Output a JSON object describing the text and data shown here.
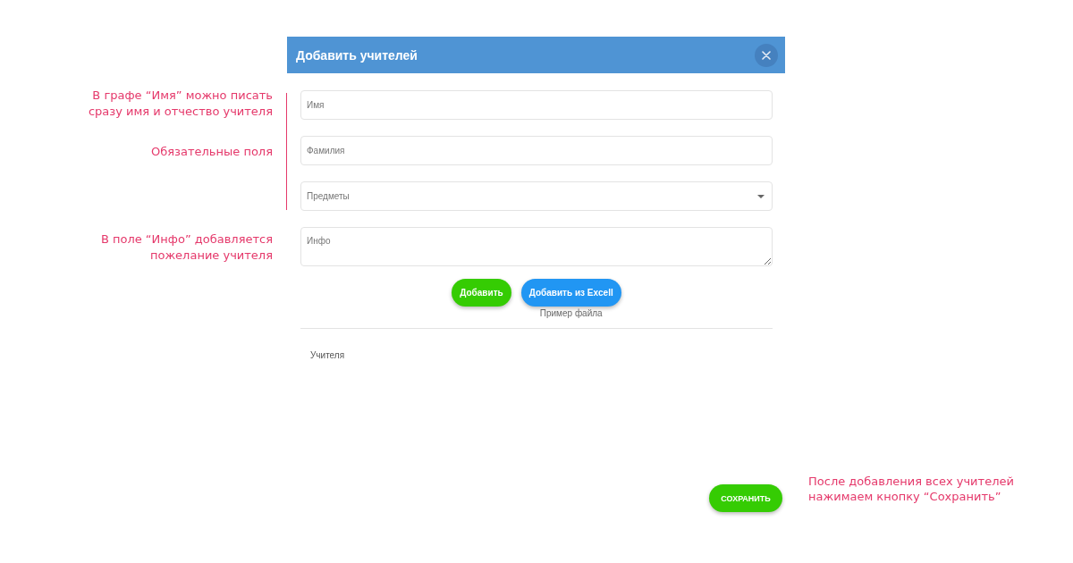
{
  "notes_left": [
    "В графе “Имя” можно писать\nсразу имя и отчество учителя",
    "Обязательные поля",
    "В поле “Инфо” добавляется\nпожелание учителя"
  ],
  "dialog": {
    "title": "Добавить учителей",
    "fields": [
      {
        "kind": "text",
        "placeholder": "Имя"
      },
      {
        "kind": "text",
        "placeholder": "Фамилия"
      },
      {
        "kind": "select",
        "placeholder": "Предметы"
      },
      {
        "kind": "textarea",
        "placeholder": "Инфо"
      }
    ],
    "buttons": [
      {
        "kind": "add",
        "label": "Добавить"
      },
      {
        "kind": "import",
        "label": "Добавить из Excell",
        "link": "Пример файла"
      }
    ],
    "list_label": "Учителя",
    "save_button": {
      "label": "СОХРАНИТЬ"
    }
  },
  "note_right": "После добавления всех учителей\nнажимаем кнопку “Сохранить”"
}
